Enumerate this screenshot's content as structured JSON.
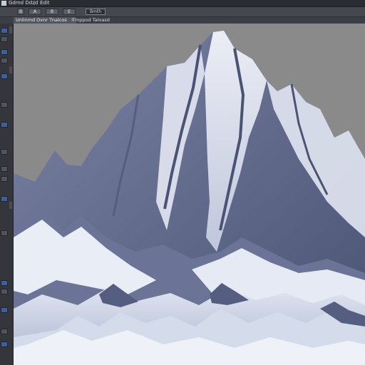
{
  "menubar": {
    "app_icon": "app-logo-icon",
    "title": "Gdmd Ddzd",
    "items": [
      "Edit"
    ]
  },
  "toolbar": {
    "combo_value": "Bmth",
    "buttons": [
      "B",
      "A",
      "B",
      "E"
    ]
  },
  "tabs": [
    {
      "label": "Unlinmd Ovnr Tnalcos",
      "active": true
    },
    {
      "label": "Tmppod Taloasd",
      "active": false
    }
  ],
  "canvas": {
    "content": "mountain-landscape",
    "sky_color": "#8a8a8a",
    "snow_color": "#eef1f8",
    "rock_color": "#5d6585"
  }
}
